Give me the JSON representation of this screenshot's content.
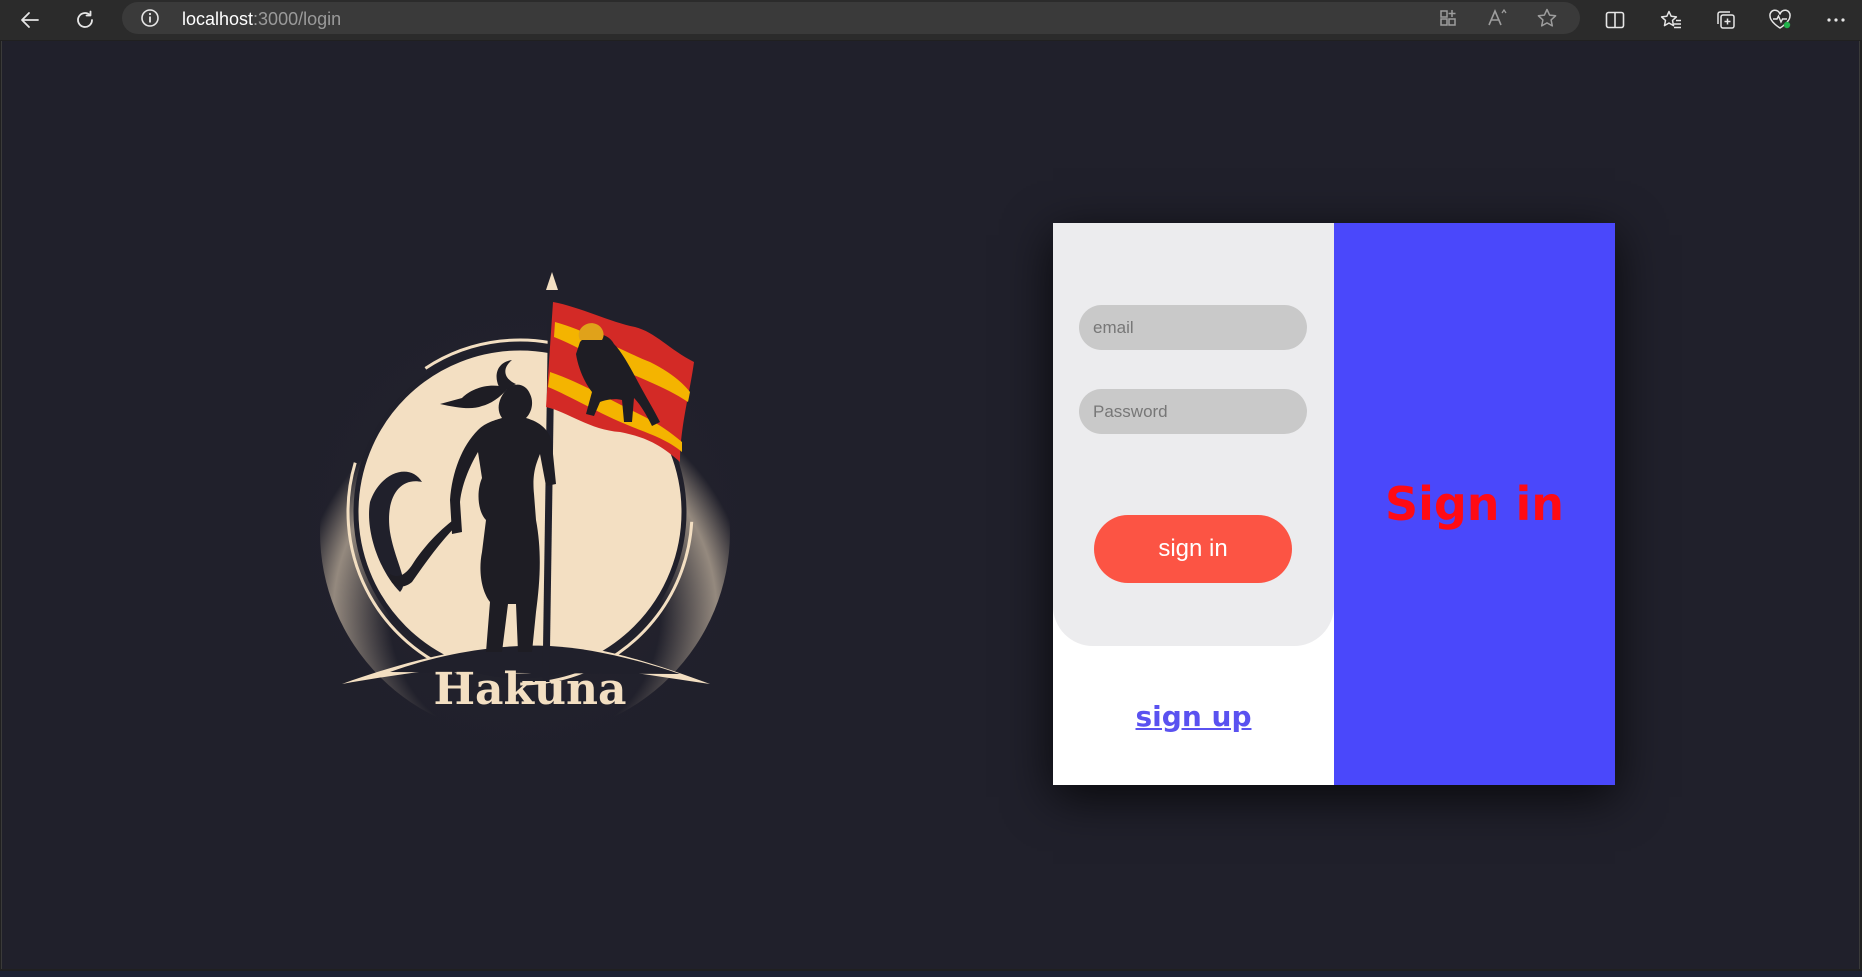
{
  "browser": {
    "url_host": "localhost",
    "url_path": ":3000/login",
    "icons": {
      "back": "back-arrow-icon",
      "refresh": "refresh-icon",
      "info": "info-icon",
      "apps": "app-available-icon",
      "read_aloud": "read-aloud-icon",
      "favorite": "star-icon",
      "split": "split-screen-icon",
      "favorites": "favorites-icon",
      "collections": "collections-icon",
      "performance": "browser-essentials-icon",
      "more": "more-icon"
    }
  },
  "logo": {
    "text": "Hakuna"
  },
  "login": {
    "email_placeholder": "email",
    "password_placeholder": "Password",
    "signin_button": "sign in",
    "signup_link": "sign up",
    "panel_title": "Sign in"
  },
  "colors": {
    "page_bg": "#20202b",
    "panel_blue": "#4a48fb",
    "title_red": "#ff0b14",
    "button_red": "#fc5444",
    "link_purple": "#5a52f0"
  }
}
